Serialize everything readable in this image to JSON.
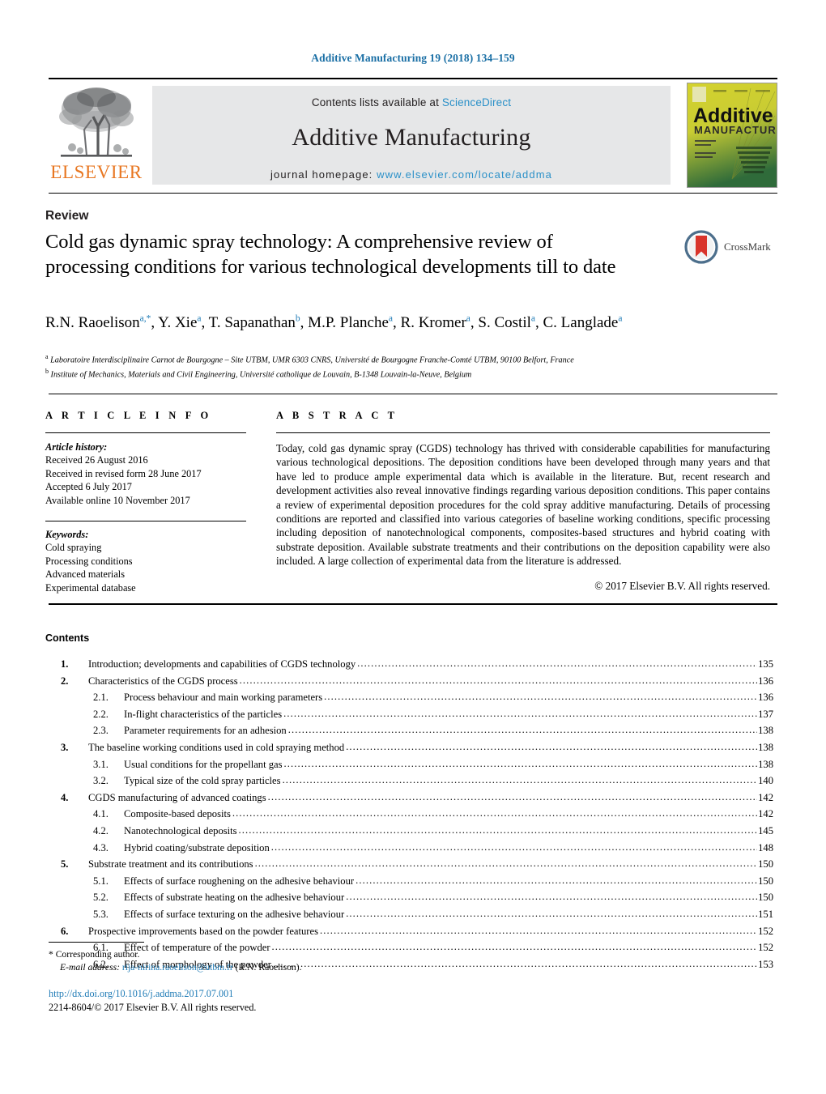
{
  "running_head": "Additive Manufacturing 19 (2018) 134–159",
  "masthead": {
    "contents_prefix": "Contents lists available at ",
    "contents_link": "ScienceDirect",
    "journal_name": "Additive Manufacturing",
    "homepage_prefix": "journal homepage: ",
    "homepage_link": "www.elsevier.com/locate/addma",
    "publisher": "ELSEVIER",
    "cover_title": "Additive",
    "cover_subtitle": "MANUFACTURING"
  },
  "article": {
    "category": "Review",
    "title": "Cold gas dynamic spray technology: A comprehensive review of processing conditions for various technological developments till to date",
    "crossmark_label": "CrossMark",
    "authors_html": "R.N. Raoelison<sup>a,*</sup>, Y. Xie<sup>a</sup>, T. Sapanathan<sup>b</sup>, M.P. Planche<sup>a</sup>, R. Kromer<sup>a</sup>, S. Costil<sup>a</sup>, C. Langlade<sup>a</sup>",
    "affiliations": [
      "Laboratoire Interdisciplinaire Carnot de Bourgogne – Site UTBM, UMR 6303 CNRS, Université de Bourgogne Franche-Comté UTBM, 90100 Belfort, France",
      "Institute of Mechanics, Materials and Civil Engineering, Université catholique de Louvain, B-1348 Louvain-la-Neuve, Belgium"
    ],
    "affiliation_marks": [
      "a",
      "b"
    ]
  },
  "article_info": {
    "heading": "A R T I C L E   I N F O",
    "history_label": "Article history:",
    "history": [
      "Received 26 August 2016",
      "Received in revised form 28 June 2017",
      "Accepted 6 July 2017",
      "Available online 10 November 2017"
    ],
    "keywords_label": "Keywords:",
    "keywords": [
      "Cold spraying",
      "Processing conditions",
      "Advanced materials",
      "Experimental database"
    ]
  },
  "abstract": {
    "heading": "A B S T R A C T",
    "text": "Today, cold gas dynamic spray (CGDS) technology has thrived with considerable capabilities for manufacturing various technological depositions. The deposition conditions have been developed through many years and that have led to produce ample experimental data which is available in the literature. But, recent research and development activities also reveal innovative findings regarding various deposition conditions. This paper contains a review of experimental deposition procedures for the cold spray additive manufacturing. Details of processing conditions are reported and classified into various categories of baseline working conditions, specific processing including deposition of nanotechnological components, composites-based structures and hybrid coating with substrate deposition. Available substrate treatments and their contributions on the deposition capability were also included. A large collection of experimental data from the literature is addressed.",
    "copyright": "© 2017 Elsevier B.V. All rights reserved."
  },
  "contents": {
    "heading": "Contents",
    "entries": [
      {
        "level": 1,
        "num": "1.",
        "label": "Introduction; developments and capabilities of CGDS technology",
        "page": "135"
      },
      {
        "level": 1,
        "num": "2.",
        "label": "Characteristics of the CGDS process",
        "page": "136"
      },
      {
        "level": 2,
        "num": "2.1.",
        "label": "Process behaviour and main working parameters",
        "page": "136"
      },
      {
        "level": 2,
        "num": "2.2.",
        "label": "In-flight characteristics of the particles",
        "page": "137"
      },
      {
        "level": 2,
        "num": "2.3.",
        "label": "Parameter requirements for an adhesion",
        "page": "138"
      },
      {
        "level": 1,
        "num": "3.",
        "label": "The baseline working conditions used in cold spraying method",
        "page": "138"
      },
      {
        "level": 2,
        "num": "3.1.",
        "label": "Usual conditions for the propellant gas",
        "page": "138"
      },
      {
        "level": 2,
        "num": "3.2.",
        "label": "Typical size of the cold spray particles",
        "page": "140"
      },
      {
        "level": 1,
        "num": "4.",
        "label": "CGDS manufacturing of advanced coatings",
        "page": "142"
      },
      {
        "level": 2,
        "num": "4.1.",
        "label": "Composite-based deposits",
        "page": "142"
      },
      {
        "level": 2,
        "num": "4.2.",
        "label": "Nanotechnological deposits",
        "page": "145"
      },
      {
        "level": 2,
        "num": "4.3.",
        "label": "Hybrid coating/substrate deposition",
        "page": "148"
      },
      {
        "level": 1,
        "num": "5.",
        "label": "Substrate treatment and its contributions",
        "page": "150"
      },
      {
        "level": 2,
        "num": "5.1.",
        "label": "Effects of surface roughening on the adhesive behaviour",
        "page": "150"
      },
      {
        "level": 2,
        "num": "5.2.",
        "label": "Effects of substrate heating on the adhesive behaviour",
        "page": "150"
      },
      {
        "level": 2,
        "num": "5.3.",
        "label": "Effects of surface texturing on the adhesive behaviour",
        "page": "151"
      },
      {
        "level": 1,
        "num": "6.",
        "label": "Prospective improvements based on the powder features",
        "page": "152"
      },
      {
        "level": 2,
        "num": "6.1.",
        "label": "Effect of temperature of the powder",
        "page": "152"
      },
      {
        "level": 2,
        "num": "6.2.",
        "label": "Effect of morphology of the powder",
        "page": "153"
      }
    ]
  },
  "footer": {
    "corresponding_marker": "*",
    "corresponding_text": "Corresponding author.",
    "email_label": "E-mail address:",
    "email": "rija-nirina.raoelison@utbm.fr",
    "email_owner": "(R.N. Raoelison).",
    "doi": "http://dx.doi.org/10.1016/j.addma.2017.07.001",
    "issn_line": "2214-8604/© 2017 Elsevier B.V. All rights reserved."
  },
  "colors": {
    "link_blue": "#1f7bb6",
    "sciencedirect_blue": "#2a90c8",
    "elsevier_orange": "#E87722",
    "band_grey": "#e6e7e8",
    "crossmark_red": "#d9342b"
  }
}
